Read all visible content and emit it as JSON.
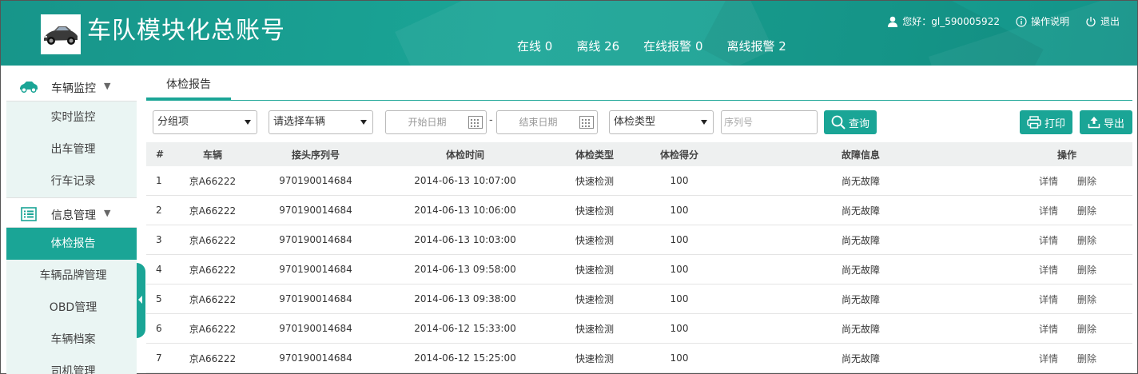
{
  "header": {
    "title": "车队模块化总账号",
    "stats": {
      "online": "在线 0",
      "offline": "离线 26",
      "online_alarm": "在线报警 0",
      "offline_alarm": "离线报警 2"
    },
    "greeting": "您好：gl_590005922",
    "help": "操作说明",
    "logout": "退出"
  },
  "sidebar": {
    "group1": {
      "label": "车辆监控",
      "items": [
        "实时监控",
        "出车管理",
        "行车记录"
      ]
    },
    "group2": {
      "label": "信息管理",
      "items": [
        "体检报告",
        "车辆品牌管理",
        "OBD管理",
        "车辆档案",
        "司机管理"
      ],
      "active": "体检报告"
    }
  },
  "tab": {
    "label": "体检报告"
  },
  "filters": {
    "group_select": "分组项",
    "vehicle_select": "请选择车辆",
    "start_date_placeholder": "开始日期",
    "date_separator": "-",
    "end_date_placeholder": "结束日期",
    "type_select": "体检类型",
    "serial_placeholder": "序列号",
    "search_button": "查询",
    "print_button": "打印",
    "export_button": "导出"
  },
  "table": {
    "columns": [
      "#",
      "车辆",
      "接头序列号",
      "体检时间",
      "体检类型",
      "体检得分",
      "故障信息",
      "操作"
    ],
    "rows": [
      {
        "n": "1",
        "vehicle": "京A66222",
        "serial": "970190014684",
        "time": "2014-06-13 10:07:00",
        "type": "快速检测",
        "score": "100",
        "fault": "尚无故障",
        "detail": "详情",
        "delete": "删除"
      },
      {
        "n": "2",
        "vehicle": "京A66222",
        "serial": "970190014684",
        "time": "2014-06-13 10:06:00",
        "type": "快速检测",
        "score": "100",
        "fault": "尚无故障",
        "detail": "详情",
        "delete": "删除"
      },
      {
        "n": "3",
        "vehicle": "京A66222",
        "serial": "970190014684",
        "time": "2014-06-13 10:03:00",
        "type": "快速检测",
        "score": "100",
        "fault": "尚无故障",
        "detail": "详情",
        "delete": "删除"
      },
      {
        "n": "4",
        "vehicle": "京A66222",
        "serial": "970190014684",
        "time": "2014-06-13 09:58:00",
        "type": "快速检测",
        "score": "100",
        "fault": "尚无故障",
        "detail": "详情",
        "delete": "删除"
      },
      {
        "n": "5",
        "vehicle": "京A66222",
        "serial": "970190014684",
        "time": "2014-06-13 09:38:00",
        "type": "快速检测",
        "score": "100",
        "fault": "尚无故障",
        "detail": "详情",
        "delete": "删除"
      },
      {
        "n": "6",
        "vehicle": "京A66222",
        "serial": "970190014684",
        "time": "2014-06-12 15:33:00",
        "type": "快速检测",
        "score": "100",
        "fault": "尚无故障",
        "detail": "详情",
        "delete": "删除"
      },
      {
        "n": "7",
        "vehicle": "京A66222",
        "serial": "970190014684",
        "time": "2014-06-12 15:25:00",
        "type": "快速检测",
        "score": "100",
        "fault": "尚无故障",
        "detail": "详情",
        "delete": "删除"
      }
    ]
  },
  "colors": {
    "accent": "#1aa596",
    "header_bg": "#17958a",
    "sidebar_bg": "#eaf5f3",
    "table_head_bg": "#eef0f0"
  },
  "icons": [
    "car-logo",
    "user-icon",
    "info-icon",
    "power-icon",
    "car-icon",
    "list-icon",
    "calendar-icon",
    "search-icon",
    "printer-icon",
    "upload-icon"
  ]
}
